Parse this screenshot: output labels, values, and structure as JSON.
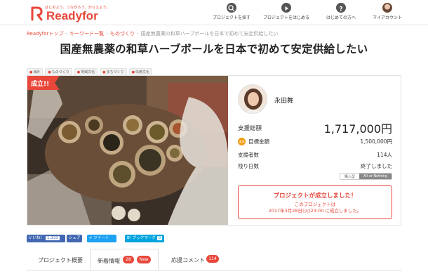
{
  "brand": {
    "tagline": "はじめよう。つながろう。かなえよう。",
    "name": "Readyfor",
    "accent": "#e8473a"
  },
  "nav": [
    {
      "label": "プロジェクトを探す",
      "icon": "search-icon"
    },
    {
      "label": "プロジェクトをはじめる",
      "icon": "play-icon"
    },
    {
      "label": "はじめての方へ",
      "icon": "question-icon"
    },
    {
      "label": "マイアカウント",
      "icon": "avatar-icon"
    }
  ],
  "breadcrumb": [
    {
      "label": "Readyforトップ",
      "link": true
    },
    {
      "label": "キーワード一覧",
      "link": true
    },
    {
      "label": "ものづくり",
      "link": true
    },
    {
      "label": "国産無農薬の和草ハーブボールを日本で初めて安定供給したい",
      "link": false
    }
  ],
  "title": "国産無農薬の和草ハーブボールを日本で初めて安定供給したい",
  "tags": [
    "海外",
    "ものづくり",
    "地域文化",
    "まちづくり",
    "伝統文化"
  ],
  "badge": "成立!!",
  "owner": {
    "name": "永田舞"
  },
  "stats": {
    "total_label": "支援総額",
    "total_value": "1,717,000円",
    "goal_badge": "達成",
    "goal_label": "目標金額",
    "goal_value": "1,500,000円",
    "backers_label": "支援者数",
    "backers_value": "114人",
    "remain_label": "残り日数",
    "remain_value": "終了しました"
  },
  "funding_type": {
    "options": [
      "購入型",
      "All or Nothing"
    ],
    "selected": "All or Nothing"
  },
  "success": {
    "heading": "プロジェクトが成立しました！",
    "line1": "このプロジェクトは",
    "line2": "2017年3月28日(火)23:00 に成立しました。"
  },
  "social": {
    "fb_label": "いいね！",
    "fb_count": "1,333",
    "share_label": "シェア",
    "tweet_label": "ツイート",
    "hatena_label": "B! ブックマーク",
    "hatena_count": "0"
  },
  "tabs": [
    {
      "label": "プロジェクト概要"
    },
    {
      "label": "新着情報",
      "count": "28",
      "extra": "New"
    },
    {
      "label": "応援コメント",
      "count": "114"
    }
  ],
  "active_tab": "新着情報"
}
